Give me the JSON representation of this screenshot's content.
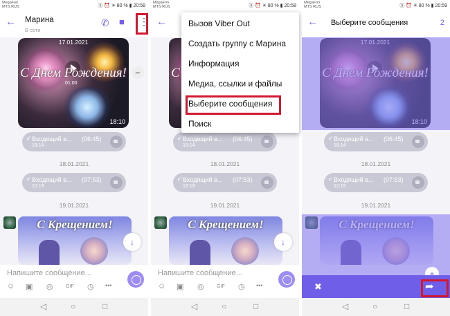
{
  "status": {
    "carrier_line1": "MegaFon",
    "carrier_line2": "MTS RUS",
    "p1": "ⓑ ⏰ ✳ 80 % ▮ 20:58",
    "p2": "ⓑ ⏰ ✳ 80 % ▮ 20:58",
    "p3": "ⓑ ⏰ ✳ 80 % ▮ 20:59"
  },
  "header": {
    "back": "←",
    "contact_name": "Марина",
    "contact_status": "В сети",
    "phone_icon": "✆",
    "video_icon": "■",
    "more_icon": "⋮"
  },
  "video_msg": {
    "date": "17.01.2021",
    "greeting": "С Днем Рождения!",
    "length": "01:00",
    "time": "18:10",
    "forward_icon": "➦"
  },
  "calls": [
    {
      "arrow": "↙",
      "label": "Входящий в...",
      "duration": "(06:45)",
      "time": "18:14"
    },
    {
      "arrow": "↙",
      "label": "Входящий в...",
      "duration": "(07:53)",
      "time": "12:19"
    }
  ],
  "dates": [
    "18.01.2021",
    "19.01.2021"
  ],
  "epiphany": {
    "text": "С Крещением!"
  },
  "scroll_icon": "↓",
  "composer": {
    "placeholder": "Напишите сообщение...",
    "tools": [
      "☺",
      "▣",
      "◎",
      "GIF",
      "◷",
      "•••"
    ]
  },
  "nav": {
    "back": "◁",
    "home": "○",
    "recent": "□"
  },
  "menu": {
    "items": [
      "Вызов Viber Out",
      "Создать группу с Марина",
      "Информация",
      "Медиа, ссылки и файлы",
      "Выберите сообщения",
      "Поиск"
    ]
  },
  "selection": {
    "title": "Выберите сообщения",
    "count": "2",
    "trash_icon": "✖",
    "forward_icon": "➦",
    "fab_icon": "+"
  },
  "colors": {
    "accent": "#7360f2",
    "highlight": "#d3172e"
  }
}
